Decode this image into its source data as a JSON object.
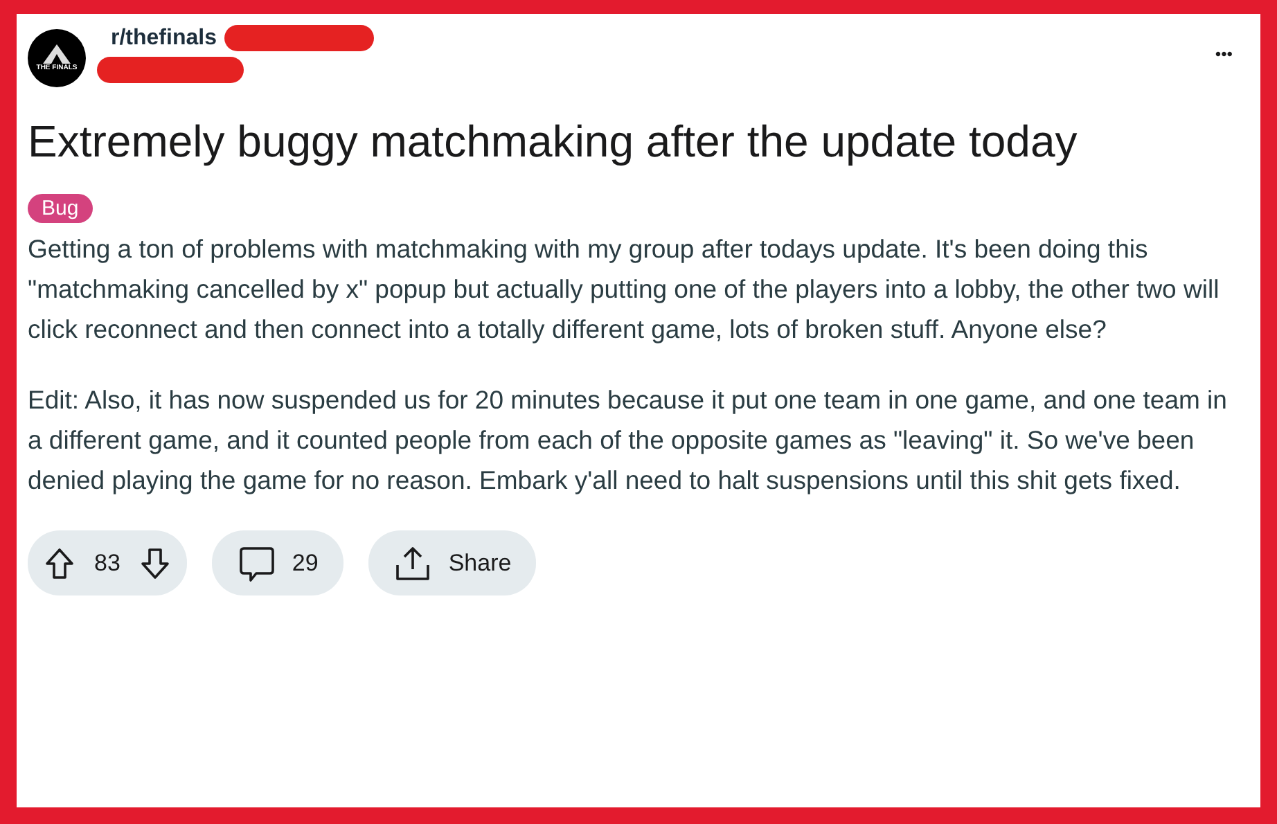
{
  "post": {
    "subreddit": "r/thefinals",
    "logo_text": "THE FINALS",
    "menu": "•••",
    "title": "Extremely buggy matchmaking after the update today",
    "flair": {
      "label": "Bug",
      "color": "#d4427e"
    },
    "body": [
      "Getting a ton of problems with matchmaking with my group after todays update. It's been doing this \"matchmaking cancelled by x\" popup but actually putting one of the players into a lobby, the other two will click reconnect and then connect into a totally different game, lots of broken stuff. Anyone else?",
      "Edit: Also, it has now suspended us for 20 minutes because it put one team in one game, and one team in a different game, and it counted people from each of the opposite games as \"leaving\" it. So we've been denied playing the game for no reason. Embark y'all need to halt suspensions until this shit gets fixed."
    ],
    "votes": "83",
    "comments": "29",
    "share": "Share"
  }
}
